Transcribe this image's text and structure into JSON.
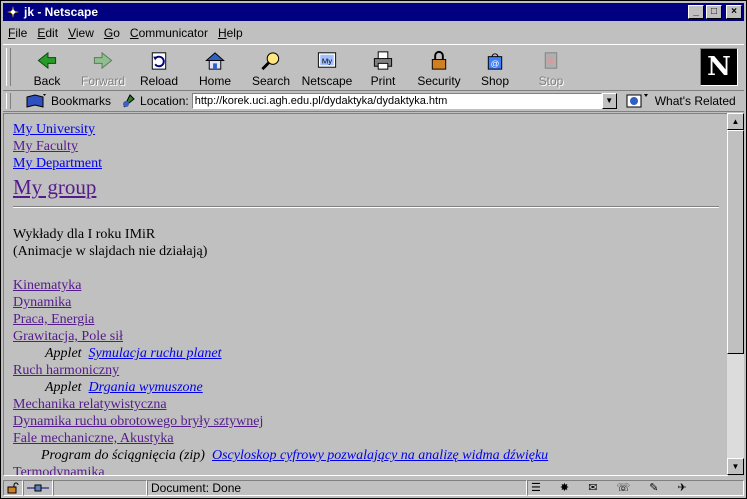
{
  "window": {
    "title": "jk - Netscape"
  },
  "menu": [
    "File",
    "Edit",
    "View",
    "Go",
    "Communicator",
    "Help"
  ],
  "toolbar": {
    "back": "Back",
    "forward": "Forward",
    "reload": "Reload",
    "home": "Home",
    "search": "Search",
    "netscape": "Netscape",
    "print": "Print",
    "security": "Security",
    "shop": "Shop",
    "stop": "Stop"
  },
  "location": {
    "bookmarks": "Bookmarks",
    "label": "Location:",
    "url": "http://korek.uci.agh.edu.pl/dydaktyka/dydaktyka.htm",
    "related": "What's Related"
  },
  "page": {
    "nav": {
      "university": "My University",
      "faculty": "My Faculty",
      "department": "My Department",
      "group": "My group"
    },
    "intro1": "Wykłady dla I roku IMiR",
    "intro2": "(Animacje w slajdach nie działają)",
    "lectures": {
      "kinematyka": "Kinematyka",
      "dynamika": "Dynamika",
      "praca": "Praca, Energia",
      "grawitacja": "Grawitacja, Pole sił",
      "applet1_prefix": "Applet",
      "applet1_link": "Symulacja ruchu planet",
      "ruch": "Ruch harmoniczny",
      "applet2_prefix": "Applet",
      "applet2_link": "Drgania wymuszone",
      "mechanika": "Mechanika relatywistyczna",
      "bryly": "Dynamika ruchu obrotowego bryły sztywnej",
      "fale": "Fale mechaniczne, Akustyka",
      "program_prefix": "Program do ściągnięcia (zip)",
      "program_link": "Oscyloskop cyfrowy pozwalający na analizę widma dźwięku",
      "cut_item": "Termodynamika"
    }
  },
  "status": {
    "text": "Document: Done"
  }
}
